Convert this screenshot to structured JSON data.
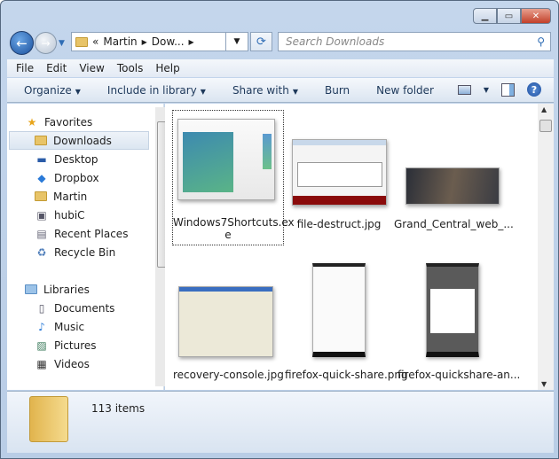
{
  "window": {
    "controls": [
      "minimize",
      "maximize",
      "close"
    ]
  },
  "address": {
    "overflow": "«",
    "crumbs": [
      "Martin",
      "Dow..."
    ],
    "search_placeholder": "Search Downloads"
  },
  "menu": [
    "File",
    "Edit",
    "View",
    "Tools",
    "Help"
  ],
  "toolbar": {
    "organize": "Organize",
    "include": "Include in library",
    "share": "Share with",
    "burn": "Burn",
    "new_folder": "New folder"
  },
  "nav": {
    "favorites": {
      "label": "Favorites",
      "items": [
        "Downloads",
        "Desktop",
        "Dropbox",
        "Martin",
        "hubiC",
        "Recent Places",
        "Recycle Bin"
      ]
    },
    "libraries": {
      "label": "Libraries",
      "items": [
        "Documents",
        "Music",
        "Pictures",
        "Videos"
      ]
    },
    "selected": "Downloads"
  },
  "files": [
    {
      "name": "Windows7Shortcuts.exe",
      "name_line1": "Windows7Shortcuts.ex",
      "name_line2": "e",
      "selected": true
    },
    {
      "name": "file-destruct.jpg"
    },
    {
      "name": "Grand_Central_web_..."
    },
    {
      "name": "recovery-console.jpg"
    },
    {
      "name": "firefox-quick-share.png"
    },
    {
      "name": "firefox-quickshare-an..."
    }
  ],
  "status": {
    "count": "113 items"
  },
  "colors": {
    "accent": "#2f6db5",
    "close": "#c2402a"
  }
}
